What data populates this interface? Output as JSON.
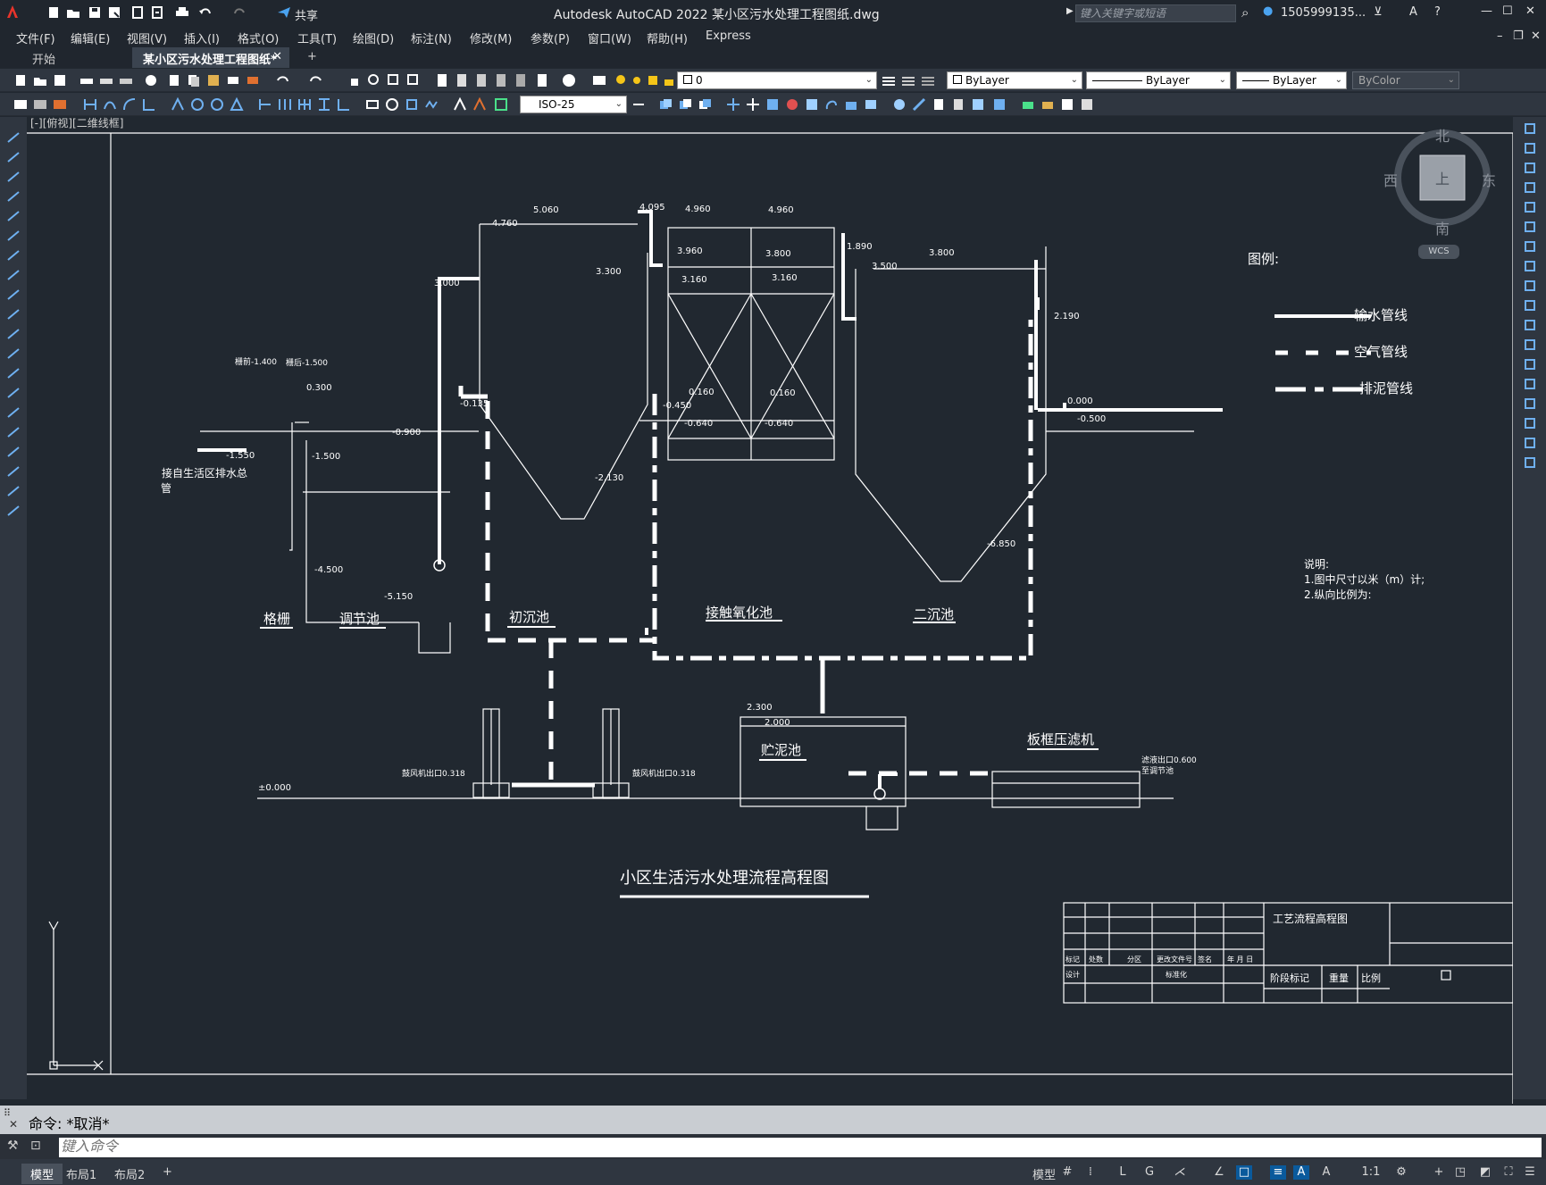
{
  "app": {
    "title": "Autodesk AutoCAD 2022    某小区污水处理工程图纸.dwg",
    "share_label": "共享",
    "search_placeholder": "键入关键字或短语",
    "user": "1505999135...",
    "help": "?"
  },
  "menu": [
    "文件(F)",
    "编辑(E)",
    "视图(V)",
    "插入(I)",
    "格式(O)",
    "工具(T)",
    "绘图(D)",
    "标注(N)",
    "修改(M)",
    "参数(P)",
    "窗口(W)",
    "帮助(H)",
    "Express"
  ],
  "tabs": [
    {
      "label": "开始",
      "active": false
    },
    {
      "label": "某小区污水处理工程图纸*",
      "active": true
    }
  ],
  "toolbar": {
    "layer_value": "0",
    "color_value": "ByLayer",
    "linetype_value": "ByLayer",
    "lineweight_value": "ByLayer",
    "plotstyle_value": "ByColor",
    "dimstyle_value": "ISO-25"
  },
  "viewport_label": "[-][俯视][二维线框]",
  "viewcube": {
    "north": "北",
    "south": "南",
    "east": "东",
    "west": "西",
    "top": "上",
    "wcs": "WCS"
  },
  "legend": {
    "title": "图例:",
    "items": [
      "输水管线",
      "空气管线",
      "排泥管线"
    ]
  },
  "notes": {
    "title": "说明:",
    "lines": [
      "1.图中尺寸以米（m）计;",
      "2.纵向比例为:"
    ]
  },
  "tank_labels": [
    "格栅",
    "调节池",
    "初沉池",
    "接触氧化池",
    "二沉池",
    "贮泥池",
    "板框压滤机"
  ],
  "elevations": [
    "5.060",
    "4.760",
    "4.095",
    "4.960",
    "4.960",
    "3.960",
    "3.800",
    "3.160",
    "3.160",
    "3.300",
    "3.000",
    "1.890",
    "3.500",
    "3.800",
    "2.190",
    "0.000",
    "-0.500",
    "0.160",
    "0.160",
    "-0.450",
    "-0.640",
    "-0.640",
    "-0.135",
    "-0.900",
    "-1.550",
    "-1.500",
    "0.300",
    "-4.500",
    "-5.150",
    "-2.130",
    "-6.850",
    "2.300",
    "2.000",
    "±0.000"
  ],
  "small_labels": {
    "before_grate": "栅前-1.400",
    "after_grate": "栅后-1.500",
    "inlet_label_1": "接自生活区排水总",
    "inlet_label_2": "管",
    "blower_out_1": "鼓风机出口0.318",
    "blower_out_2": "鼓风机出口0.318",
    "filtrate_1": "滤液出口0.600",
    "filtrate_2": "至调节池"
  },
  "drawing_title": "小区生活污水处理流程高程图",
  "titleblock": {
    "name": "工艺流程高程图",
    "row_labels": [
      "标记",
      "处数",
      "分区",
      "更改文件号",
      "签名",
      "年 月 日"
    ],
    "design": "设计",
    "standard": "标准化",
    "stage": "阶段标记",
    "weight": "重量",
    "scale": "比例"
  },
  "command": {
    "history": "命令:  *取消*",
    "placeholder": "键入命令"
  },
  "status": {
    "tabs": [
      "模型",
      "布局1",
      "布局2"
    ],
    "model": "模型",
    "scale": "1:1"
  }
}
